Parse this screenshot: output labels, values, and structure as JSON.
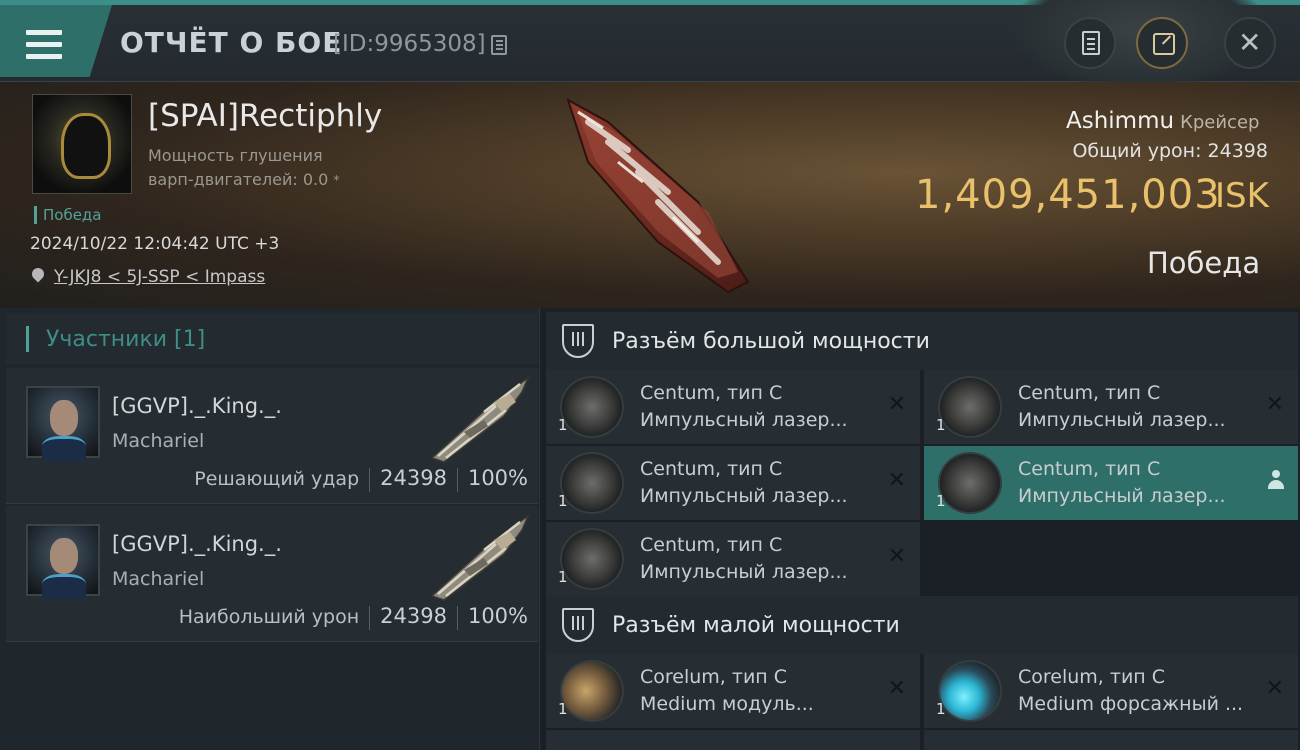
{
  "header": {
    "title": "ОТЧЁТ О БОЕ",
    "report_id": "[ID:9965308]",
    "colors": {
      "accent": "#3c8f88",
      "header_bg": "#23292e"
    }
  },
  "victim": {
    "pilot_name": "[SPAI]Rectiphly",
    "warp_disrupt_line1": "Мощность глушения",
    "warp_disrupt_line2": "варп-двигателей: 0.0",
    "status": "Победа",
    "datetime": "2024/10/22 12:04:42 UTC +3",
    "location": "Y-JKJ8 < 5J-SSP < Impass",
    "ship_name": "Ashimmu",
    "ship_class": "Крейсер",
    "total_damage_label": "Общий урон:",
    "total_damage": "24398",
    "isk_value": "1,409,451,003",
    "isk_unit": "ISK",
    "result": "Победа",
    "isk_color": "#e8c16a"
  },
  "participants": {
    "title": "Участники [1]",
    "list": [
      {
        "name": "[GGVP]._.King._.",
        "ship": "Machariel",
        "role": "Решающий удар",
        "damage": "24398",
        "percent": "100%"
      },
      {
        "name": "[GGVP]._.King._.",
        "ship": "Machariel",
        "role": "Наибольший урон",
        "damage": "24398",
        "percent": "100%"
      }
    ]
  },
  "high_slots": {
    "title": "Разъём большой мощности",
    "modules": [
      {
        "qty": "1",
        "name": "Centum, тип C",
        "type": "Импульсный лазер..."
      },
      {
        "qty": "1",
        "name": "Centum, тип C",
        "type": "Импульсный лазер..."
      },
      {
        "qty": "1",
        "name": "Centum, тип C",
        "type": "Импульсный лазер..."
      },
      {
        "qty": "1",
        "name": "Centum, тип C",
        "type": "Импульсный лазер..."
      },
      {
        "qty": "1",
        "name": "Centum, тип C",
        "type": "Импульсный лазер..."
      }
    ]
  },
  "low_slots": {
    "title": "Разъём малой мощности",
    "modules": [
      {
        "qty": "1",
        "name": "Corelum, тип C",
        "type": "Medium модуль..."
      },
      {
        "qty": "1",
        "name": "Corelum, тип C",
        "type": "Medium форсажный ..."
      }
    ]
  },
  "icons": {
    "close_mark": "✕",
    "dismiss_mark": "✕"
  }
}
